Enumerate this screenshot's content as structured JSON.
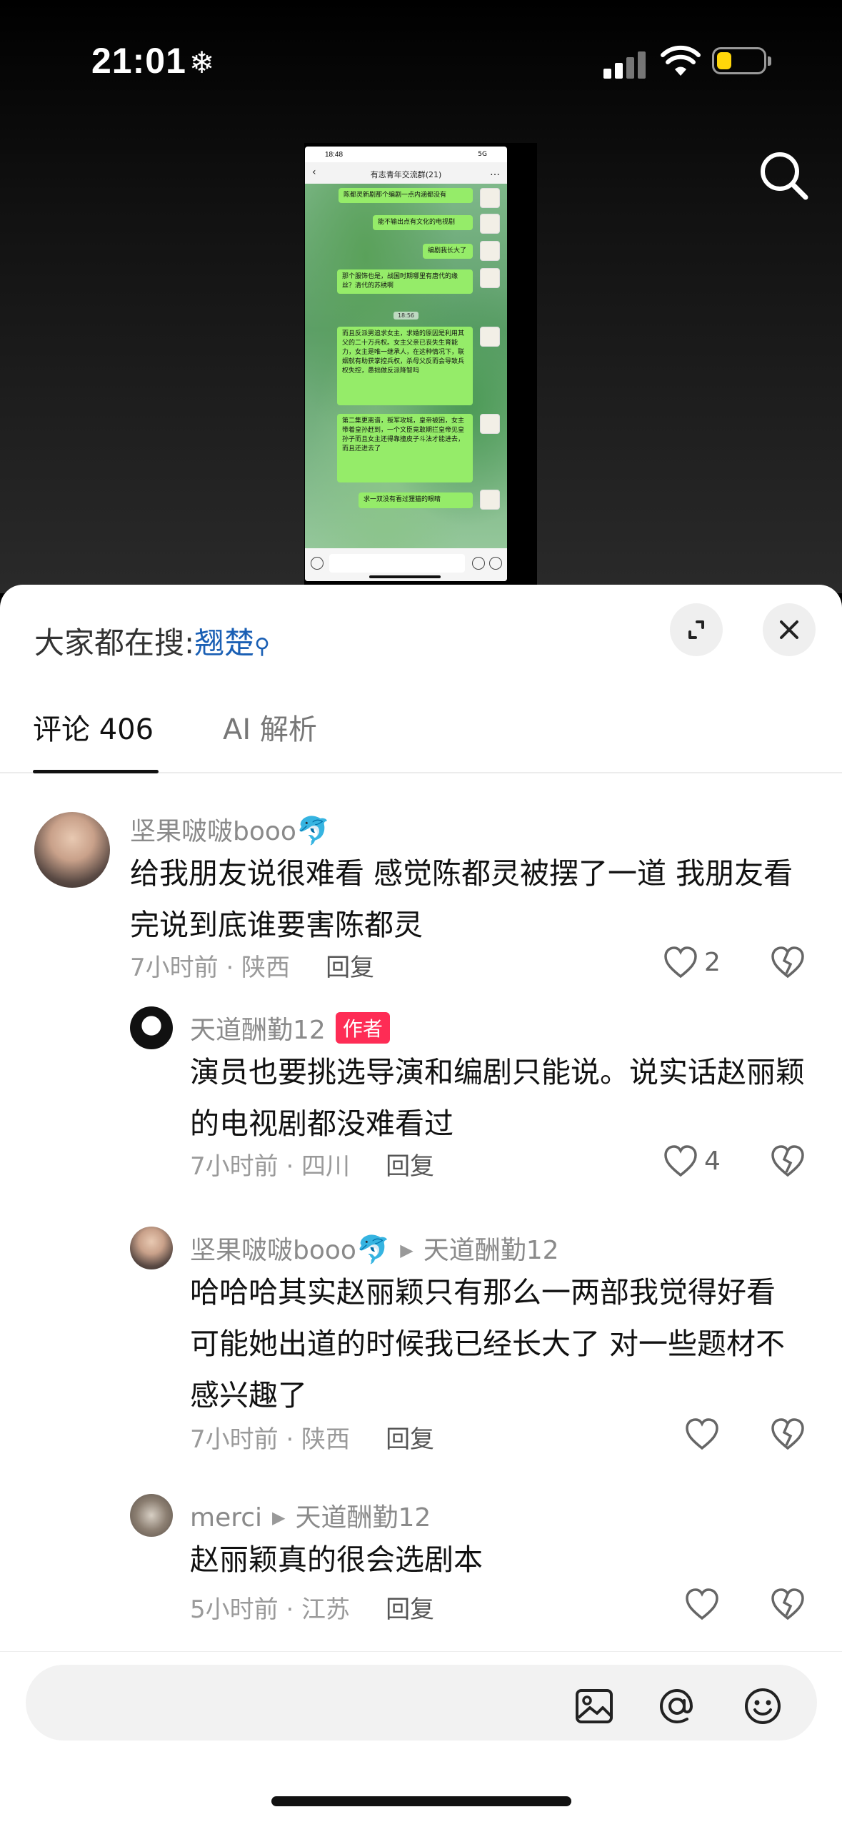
{
  "status_bar": {
    "time": "21:01",
    "weather_icon": "❄",
    "battery_color": "#ffd60a"
  },
  "video": {
    "screenshot": {
      "time": "18:48",
      "status_right": "5G",
      "chat_title": "有志青年交流群(21)",
      "messages": [
        "陈都灵新剧那个编剧一点内涵都没有",
        "能不输出点有文化的电视剧",
        "编剧我长大了",
        "那个服饰也是，战国时期哪里有唐代的缘丝？清代的苏绣啊",
        "而且反派男追求女主，求婚的原因是利用其父的二十万兵权。女主父亲已丧失生育能力，女主是唯一继承人，在这种情况下，联姻就有助获掌控兵权，杀母父反而会导致兵权失控，愚拙做反派降智吗",
        "第二集更离谱，叛军攻城，皇帝被困，女主带着皇孙赶到，一个文臣竟敢期拦皇帝见皇孙子而且女主还得靠撞皮子斗法才能进去，而且还进去了",
        "求一双没有看过狸猫的眼睛"
      ],
      "time_divider": "18:56"
    }
  },
  "panel": {
    "hot_search_label": "大家都在搜:",
    "hot_search_keyword": "翘楚",
    "tabs": [
      {
        "label": "评论 406"
      },
      {
        "label": "AI 解析"
      }
    ],
    "comments": [
      {
        "user": "坚果啵啵booo",
        "emoji": "🐬",
        "text": "给我朋友说很难看 感觉陈都灵被摆了一道 我朋友看完说到底谁要害陈都灵",
        "time_location": "7小时前 · 陕西",
        "reply_label": "回复",
        "likes": "2"
      },
      {
        "user": "天道酬勤12",
        "badge": "作者",
        "text": "演员也要挑选导演和编剧只能说。说实话赵丽颖的电视剧都没难看过",
        "time_location": "7小时前 · 四川",
        "reply_label": "回复",
        "likes": "4"
      },
      {
        "user": "坚果啵啵booo",
        "emoji": "🐬",
        "reply_to": "天道酬勤12",
        "text": "哈哈哈其实赵丽颖只有那么一两部我觉得好看 可能她出道的时候我已经长大了 对一些题材不感兴趣了",
        "time_location": "7小时前 · 陕西",
        "reply_label": "回复",
        "likes": ""
      },
      {
        "user": "merci",
        "reply_to": "天道酬勤12",
        "text": "赵丽颖真的很会选剧本",
        "time_location": "5小时前 · 江苏",
        "reply_label": "回复",
        "likes": ""
      }
    ],
    "input_bar": {
      "placeholder": ""
    },
    "colors": {
      "author_badge": "#fe2c55",
      "hot_keyword": "#1a5fb4"
    }
  }
}
